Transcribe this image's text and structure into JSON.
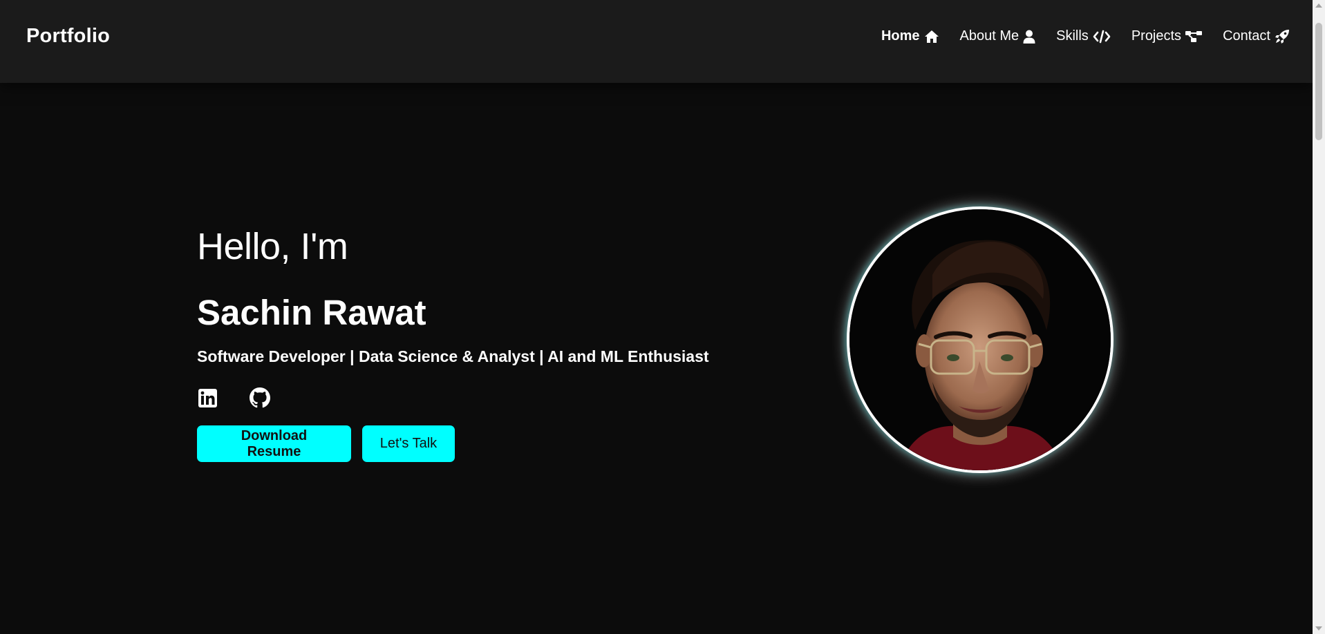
{
  "brand": "Portfolio",
  "nav": [
    {
      "label": "Home",
      "icon": "home-icon"
    },
    {
      "label": "About Me",
      "icon": "user-icon"
    },
    {
      "label": "Skills",
      "icon": "code-icon"
    },
    {
      "label": "Projects",
      "icon": "project-diagram-icon"
    },
    {
      "label": "Contact",
      "icon": "rocket-icon"
    }
  ],
  "hero": {
    "greeting": "Hello, I'm",
    "name": "Sachin Rawat",
    "tagline": "Software Developer | Data Science & Analyst | AI and ML Enthusiast",
    "socials": [
      {
        "icon": "linkedin-icon"
      },
      {
        "icon": "github-icon"
      }
    ],
    "buttons": {
      "download": "Download Resume",
      "talk": "Let's Talk"
    }
  },
  "colors": {
    "background": "#0c0c0c",
    "navbar": "#1b1b1b",
    "accent": "#00ffff",
    "text": "#ffffff"
  }
}
